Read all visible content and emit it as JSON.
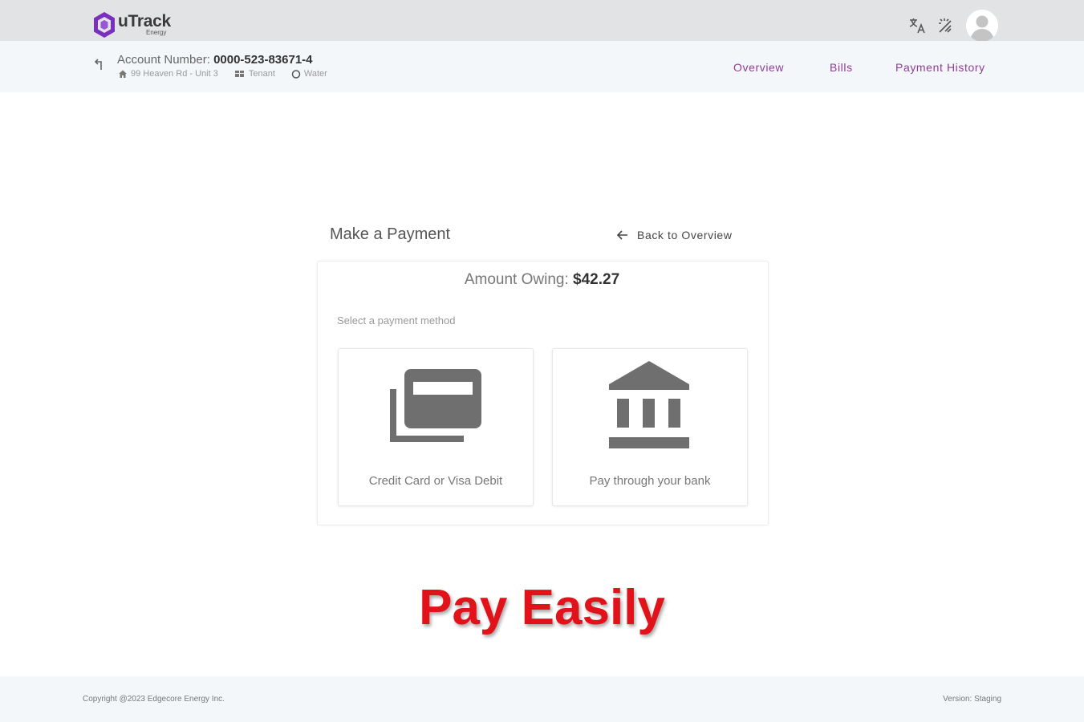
{
  "header": {
    "logo_text": "uTrack",
    "logo_subtext": "Energy",
    "brand_color": "#7b2fbe"
  },
  "account": {
    "label": "Account Number:",
    "number": "0000-523-83671-4",
    "address": "99 Heaven Rd - Unit 3",
    "role": "Tenant",
    "service": "Water"
  },
  "nav": {
    "overview": "Overview",
    "bills": "Bills",
    "payment_history": "Payment History",
    "accent_color": "#8e3c96"
  },
  "payment": {
    "title": "Make a Payment",
    "back_label": "Back to Overview",
    "amount_label": "Amount Owing:",
    "amount_value": "$42.27",
    "select_label": "Select a payment method",
    "methods": [
      {
        "label": "Credit Card or Visa Debit",
        "icon": "credit-card-icon"
      },
      {
        "label": "Pay through your bank",
        "icon": "bank-icon"
      }
    ]
  },
  "banner": {
    "text": "Pay Easily",
    "color": "#e1121a"
  },
  "footer": {
    "copyright": "Copyright @2023 Edgecore Energy Inc.",
    "version": "Version: Staging"
  }
}
